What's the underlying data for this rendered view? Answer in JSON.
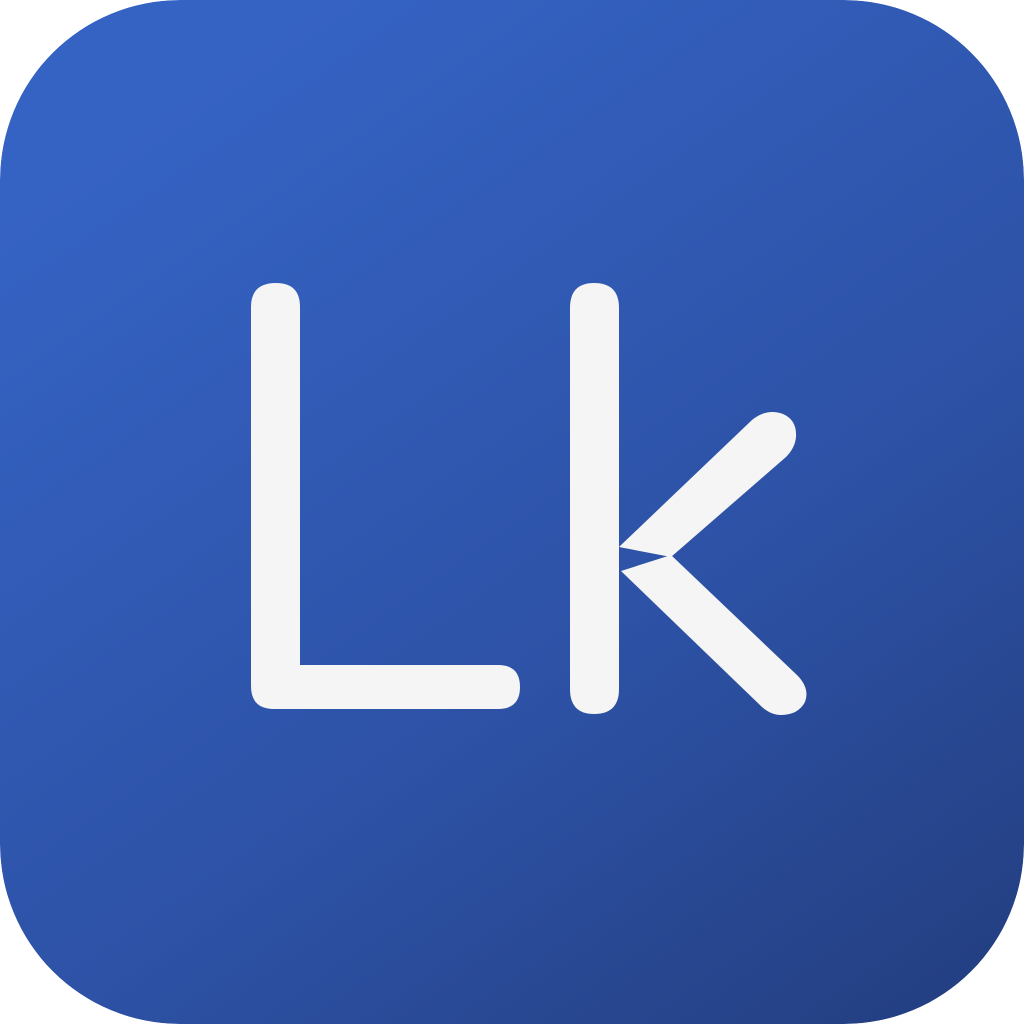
{
  "icon": {
    "monogram": "Lk",
    "colors": {
      "gradient_start": "#3563C4",
      "gradient_mid": "#2D52A6",
      "gradient_end": "#233D7E",
      "glyph": "#F5F5F5"
    }
  }
}
